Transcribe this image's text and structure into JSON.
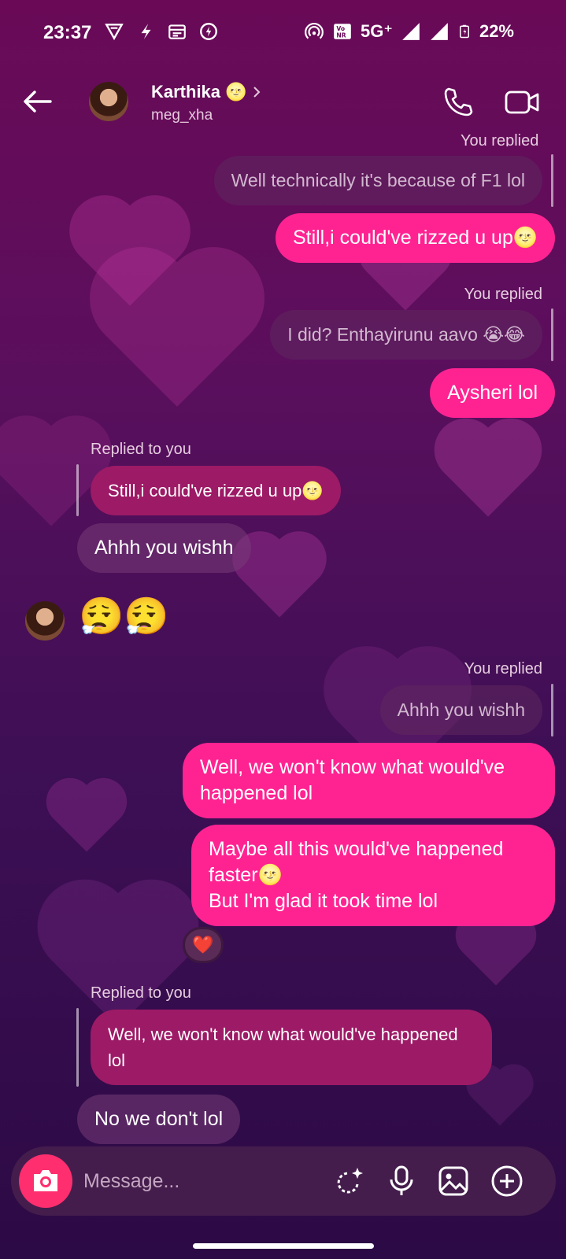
{
  "status_bar": {
    "time": "23:37",
    "network": "5G⁺",
    "battery": "22%",
    "icons": [
      "vpn-icon",
      "flash-app-icon",
      "calendar-icon",
      "charging-icon",
      "hotspot-icon",
      "volte-icon",
      "signal-icon",
      "battery-icon"
    ]
  },
  "header": {
    "name": "Karthika",
    "name_emoji": "🌝",
    "username": "meg_xha",
    "icons": [
      "back-arrow-icon",
      "chevron-right-icon",
      "phone-icon",
      "video-camera-icon"
    ]
  },
  "messages": {
    "m1_quote": "Well technically it's because of F1 lol",
    "m2_text": "Still,i could've rizzed u up🌝",
    "m3_label": "You replied",
    "m3_quote": "I did? Enthayirunu aavo 😭😂",
    "m4_text": "Aysheri lol",
    "m5_label": "Replied to you",
    "m5_quote": "Still,i could've rizzed u up🌝",
    "m6_text": "Ahhh you wishh",
    "m7_emojis": "😮‍💨😮‍💨",
    "m8_label": "You replied",
    "m8_quote": "Ahhh you wishh",
    "m9_text": "Well, we won't know what would've happened lol",
    "m10_line1": "Maybe all this would've happened faster🌝",
    "m10_line2": "But I'm glad it took time lol",
    "m10_reaction": "❤️",
    "m11_label": "Replied to you",
    "m11_quote": "Well, we won't know what would've happened lol",
    "m12_text": "No we don't lol",
    "top_partial_label": "You replied"
  },
  "composer": {
    "placeholder": "Message...",
    "icons": [
      "camera-icon",
      "sticker-sparkle-icon",
      "microphone-icon",
      "gallery-icon",
      "plus-icon"
    ]
  },
  "colors": {
    "outgoing_bubble": "#ff2392",
    "incoming_bubble": "#7a3c78",
    "background_top": "#6a0a57",
    "background_bottom": "#2c0a45",
    "camera_button": "#ff2e6e"
  }
}
